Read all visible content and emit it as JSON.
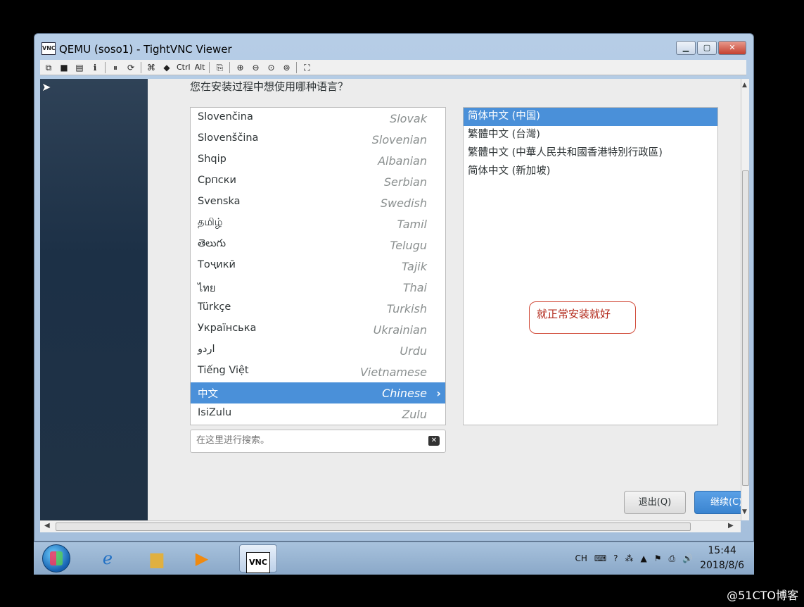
{
  "window": {
    "title": "QEMU (soso1) - TightVNC Viewer",
    "app_icon_label": "VNC",
    "buttons": {
      "minimize": "▁",
      "maximize": "▢",
      "close": "✕"
    }
  },
  "toolbar": {
    "ctrl_label": "Ctrl",
    "alt_label": "Alt"
  },
  "installer": {
    "question": "您在安装过程中想使用哪种语言？",
    "languages": [
      {
        "native": "Slovenčina",
        "english": "Slovak"
      },
      {
        "native": "Slovenščina",
        "english": "Slovenian"
      },
      {
        "native": "Shqip",
        "english": "Albanian"
      },
      {
        "native": "Српски",
        "english": "Serbian"
      },
      {
        "native": "Svenska",
        "english": "Swedish"
      },
      {
        "native": "தமிழ்",
        "english": "Tamil"
      },
      {
        "native": "తెలుగు",
        "english": "Telugu"
      },
      {
        "native": "Тоҷикӣ",
        "english": "Tajik"
      },
      {
        "native": "ไทย",
        "english": "Thai"
      },
      {
        "native": "Türkçe",
        "english": "Turkish"
      },
      {
        "native": "Українська",
        "english": "Ukrainian"
      },
      {
        "native": "اردو",
        "english": "Urdu"
      },
      {
        "native": "Tiếng Việt",
        "english": "Vietnamese"
      },
      {
        "native": "中文",
        "english": "Chinese",
        "selected": true
      },
      {
        "native": "IsiZulu",
        "english": "Zulu"
      }
    ],
    "locales": [
      {
        "label": "简体中文 (中国)",
        "selected": true
      },
      {
        "label": "繁體中文 (台灣)"
      },
      {
        "label": "繁體中文 (中華人民共和國香港特別行政區)"
      },
      {
        "label": "简体中文 (新加坡)"
      }
    ],
    "annotation": "就正常安装就好",
    "search_placeholder": "在这里进行搜索。",
    "quit_button": "退出(Q)",
    "continue_button": "继续(C)"
  },
  "taskbar": {
    "tray": {
      "input_lang": "CH",
      "time": "15:44",
      "date": "2018/8/6"
    }
  },
  "watermark": "@51CTO博客",
  "colors": {
    "selection": "#4a90d9",
    "annotation": "#d14b3a"
  }
}
